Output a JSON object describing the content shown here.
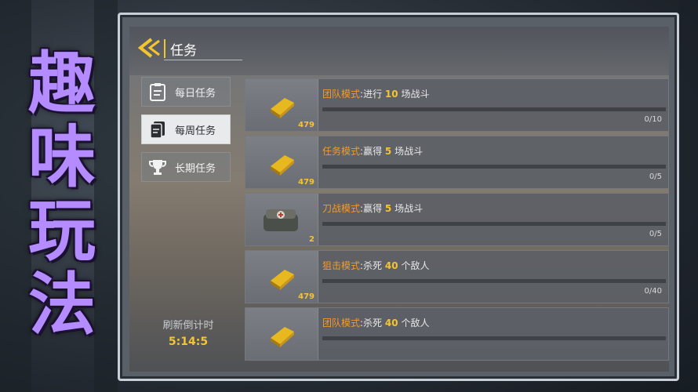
{
  "promo_title": [
    "趣",
    "味",
    "玩",
    "法"
  ],
  "screen": {
    "title": "任务",
    "back_icon": "chevron-left-double-icon",
    "accent_color": "#f4c431",
    "mode_color": "#f39a2a"
  },
  "tabs": [
    {
      "label": "每日任务",
      "icon": "clipboard-list-icon",
      "active": false
    },
    {
      "label": "每周任务",
      "icon": "document-stack-icon",
      "active": true
    },
    {
      "label": "长期任务",
      "icon": "trophy-icon",
      "active": false
    }
  ],
  "refresh": {
    "label": "刷新倒计时",
    "countdown": "5:14:5"
  },
  "tasks": [
    {
      "mode": "团队模式",
      "sep": ":",
      "verb": "进行",
      "count": "10",
      "unit": "场战斗",
      "reward_icon": "gold-bar-icon",
      "reward_amount": "479",
      "progress": "0/10",
      "progress_fraction": 0
    },
    {
      "mode": "任务模式",
      "sep": ":",
      "verb": "赢得",
      "count": "5",
      "unit": "场战斗",
      "reward_icon": "gold-bar-icon",
      "reward_amount": "479",
      "progress": "0/5",
      "progress_fraction": 0
    },
    {
      "mode": "刀战模式",
      "sep": ":",
      "verb": "赢得",
      "count": "5",
      "unit": "场战斗",
      "reward_icon": "medkit-icon",
      "reward_amount": "2",
      "progress": "0/5",
      "progress_fraction": 0
    },
    {
      "mode": "狙击模式",
      "sep": ":",
      "verb": "杀死",
      "count": "40",
      "unit": "个敌人",
      "reward_icon": "gold-bar-icon",
      "reward_amount": "479",
      "progress": "0/40",
      "progress_fraction": 0
    },
    {
      "mode": "团队模式",
      "sep": ":",
      "verb": "杀死",
      "count": "40",
      "unit": "个敌人",
      "reward_icon": "gold-bar-icon",
      "reward_amount": "",
      "progress": "",
      "progress_fraction": 0
    }
  ]
}
